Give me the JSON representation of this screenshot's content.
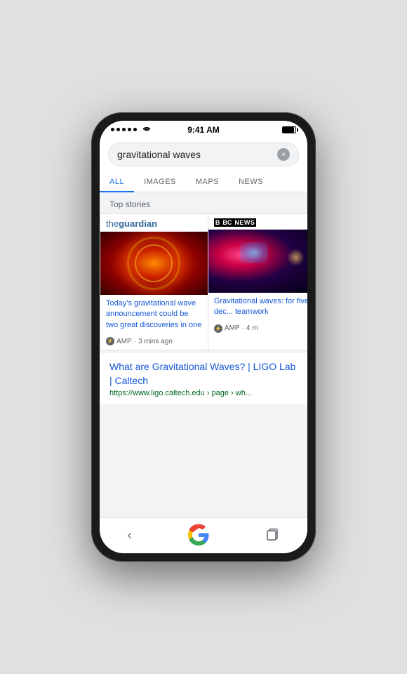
{
  "phone": {
    "status_bar": {
      "time": "9:41 AM",
      "signal_dots": 5,
      "wifi": true,
      "battery_full": true
    },
    "search_bar": {
      "query": "gravitational waves",
      "clear_label": "×"
    },
    "tabs": [
      {
        "label": "ALL",
        "active": true
      },
      {
        "label": "IMAGES",
        "active": false
      },
      {
        "label": "MAPS",
        "active": false
      },
      {
        "label": "NEWS",
        "active": false
      }
    ],
    "top_stories_label": "Top stories",
    "stories": [
      {
        "source": "the guardian",
        "source_display": "theguardian",
        "title": "Today's gravitational wave announcement could be two great discoveries in one",
        "amp_label": "AMP",
        "time_ago": "3 mins ago"
      },
      {
        "source": "BBC News",
        "title": "Gravitational waves: for five dec... teamwork",
        "amp_label": "AMP",
        "time_ago": "4 m"
      }
    ],
    "search_result": {
      "title": "What are Gravitational Waves? | LIGO Lab | Caltech",
      "url": "https://www.ligo.caltech.edu › page › wh..."
    },
    "bottom_nav": {
      "back_label": "‹",
      "tabs_label": "⧉"
    }
  }
}
